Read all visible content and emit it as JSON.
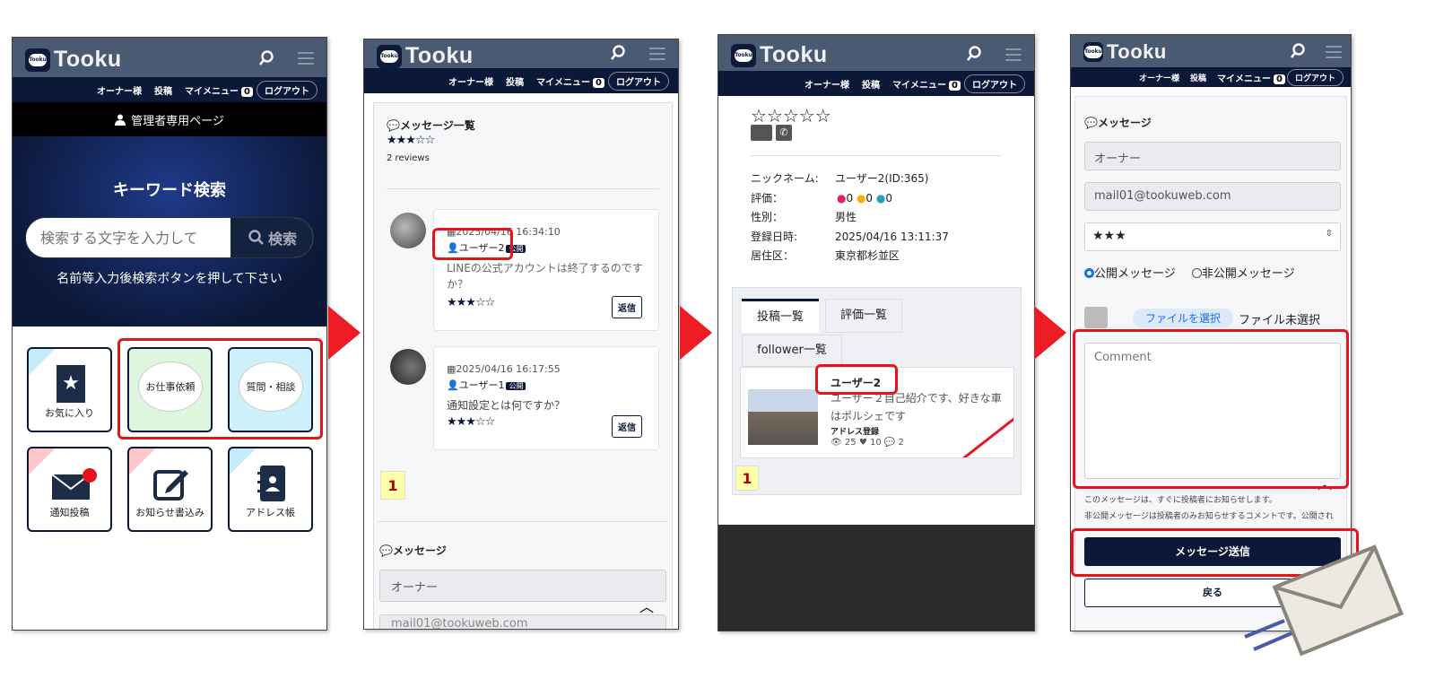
{
  "app": {
    "logo": "Tooku",
    "badge": "Tooku",
    "nav": {
      "owner": "オーナー様",
      "post": "投稿",
      "mymenu": "マイメニュー",
      "count": "0",
      "logout": "ログアウト"
    }
  },
  "screen1": {
    "admin_label": "管理者専用ページ",
    "search_title": "キーワード検索",
    "search_placeholder": "検索する文字を入力して",
    "search_button": "検索",
    "search_hint": "名前等入力後検索ボタンを押して下さい",
    "tiles": [
      "お気に入り",
      "お仕事依頼",
      "質問・相談",
      "通知投稿",
      "お知らせ書込み",
      "アドレス帳"
    ]
  },
  "screen2": {
    "section_title": "メッセージ一覧",
    "rating": "★★★☆☆",
    "reviews": "2 reviews",
    "messages": [
      {
        "date": "2025/04/16 16:34:10",
        "user": "ユーザー2",
        "tag": "公開",
        "text": "LINEの公式アカウントは終了するのですか？",
        "rating": "★★★☆☆",
        "reply": "返信"
      },
      {
        "date": "2025/04/16 16:17:55",
        "user": "ユーザー1",
        "tag": "公開",
        "text": "通知設定とは何ですか？",
        "rating": "★★★☆☆",
        "reply": "返信"
      }
    ],
    "page": "1",
    "form_title": "メッセージ",
    "owner_field": "オーナー",
    "email_field": "mail01@tookuweb.com"
  },
  "screen3": {
    "stars": "☆☆☆☆☆",
    "profile": [
      {
        "k": "ニックネーム:",
        "v": "ユーザー2(ID:365)"
      },
      {
        "k": "評価：",
        "v": "0 0 0"
      },
      {
        "k": "性別：",
        "v": "男性"
      },
      {
        "k": "登録日時:",
        "v": "2025/04/16 13:11:37"
      },
      {
        "k": "居住区：",
        "v": "東京都杉並区"
      }
    ],
    "tabs": [
      "投稿一覧",
      "評価一覧",
      "follower一覧"
    ],
    "post": {
      "user": "ユーザー2",
      "text": "ユーザー２自己紹介です、好きな車はポルシェです",
      "tag": "アドレス登録",
      "views": "25",
      "likes": "10",
      "comments": "2"
    },
    "page": "1"
  },
  "screen4": {
    "form_title": "メッセージ",
    "owner_field": "オーナー",
    "email_field": "mail01@tookuweb.com",
    "rating_select": "★★★",
    "radio_public": "公開メッセージ",
    "radio_private": "非公開メッセージ",
    "file_button": "ファイルを選択",
    "file_status": "ファイル未選択",
    "comment_placeholder": "Comment",
    "note1": "このメッセージは、すぐに投稿者にお知らせします。",
    "note2": "非公開メッセージは投稿者のみお知らせするコメントです。公開され",
    "send_button": "メッセージ送信",
    "back_button": "戻る"
  },
  "colors": {
    "navy": "#0c1838",
    "header": "#4a5a72",
    "red": "#e8131a"
  }
}
